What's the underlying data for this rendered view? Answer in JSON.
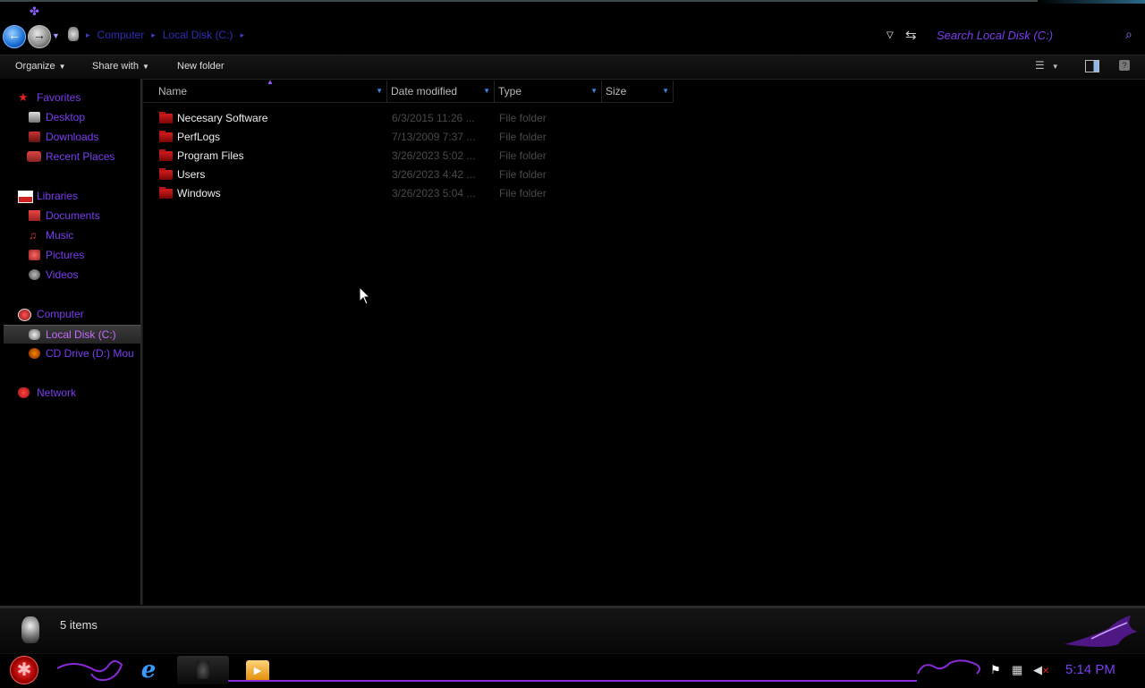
{
  "address_bar": {
    "breadcrumb": [
      "Computer",
      "Local Disk (C:)"
    ],
    "search_placeholder": "Search Local Disk (C:)"
  },
  "toolbar": {
    "organize": "Organize",
    "share_with": "Share with",
    "new_folder": "New folder"
  },
  "nav": {
    "favorites": {
      "label": "Favorites",
      "items": [
        {
          "label": "Desktop"
        },
        {
          "label": "Downloads"
        },
        {
          "label": "Recent Places"
        }
      ]
    },
    "libraries": {
      "label": "Libraries",
      "items": [
        {
          "label": "Documents"
        },
        {
          "label": "Music"
        },
        {
          "label": "Pictures"
        },
        {
          "label": "Videos"
        }
      ]
    },
    "computer": {
      "label": "Computer",
      "items": [
        {
          "label": "Local Disk (C:)",
          "selected": true
        },
        {
          "label": "CD Drive (D:) Mou"
        }
      ]
    },
    "network": {
      "label": "Network"
    }
  },
  "columns": [
    "Name",
    "Date modified",
    "Type",
    "Size"
  ],
  "files": [
    {
      "name": "Necesary Software",
      "date": "6/3/2015 11:26 ...",
      "type": "File folder"
    },
    {
      "name": "PerfLogs",
      "date": "7/13/2009 7:37 ...",
      "type": "File folder"
    },
    {
      "name": "Program Files",
      "date": "3/26/2023 5:02 ...",
      "type": "File folder"
    },
    {
      "name": "Users",
      "date": "3/26/2023 4:42 ...",
      "type": "File folder"
    },
    {
      "name": "Windows",
      "date": "3/26/2023 5:04 ...",
      "type": "File folder"
    }
  ],
  "status": {
    "item_count": "5 items"
  },
  "taskbar": {
    "clock": "5:14 PM"
  },
  "colors": {
    "accent_purple": "#7a3df0",
    "folder_red": "#c01515",
    "text_dim": "#4a4a4a"
  }
}
